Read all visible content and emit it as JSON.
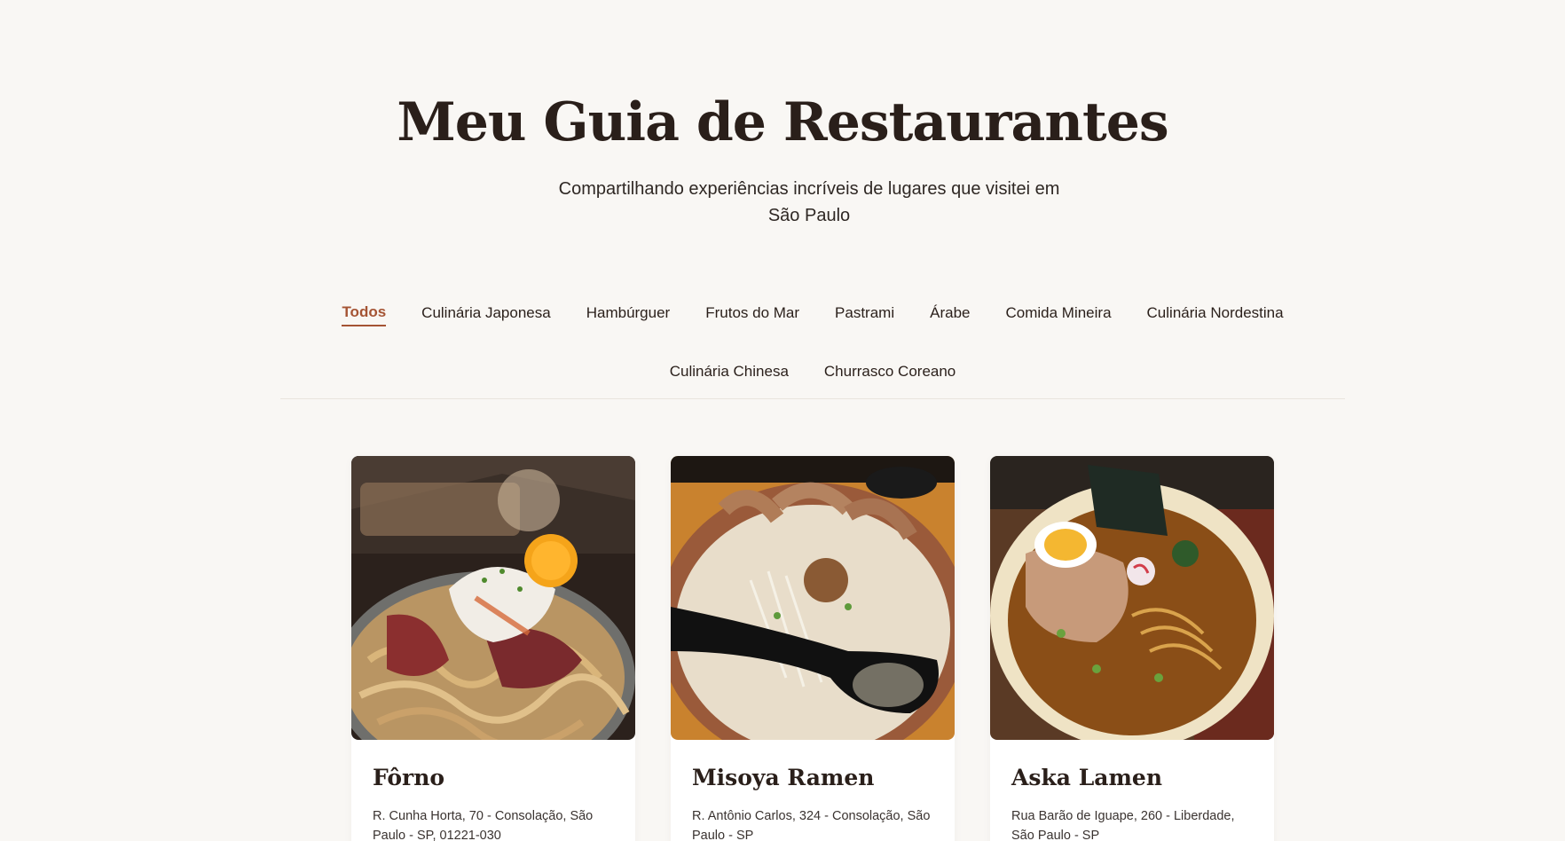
{
  "header": {
    "title": "Meu Guia de Restaurantes",
    "subtitle": "Compartilhando experiências incríveis de lugares que visitei em São Paulo"
  },
  "filters": {
    "active": "Todos",
    "items": [
      "Todos",
      "Culinária Japonesa",
      "Hambúrguer",
      "Frutos do Mar",
      "Pastrami",
      "Árabe",
      "Comida Mineira",
      "Culinária Nordestina",
      "Culinária Chinesa",
      "Churrasco Coreano"
    ]
  },
  "restaurants": [
    {
      "name": "Fôrno",
      "address": "R. Cunha Horta, 70 - Consolação, São Paulo - SP, 01221-030",
      "photo": "noodles-with-pastrami-and-egg-photo"
    },
    {
      "name": "Misoya Ramen",
      "address": "R. Antônio Carlos, 324 - Consolação, São Paulo - SP",
      "photo": "miso-ramen-with-chashu-photo"
    },
    {
      "name": "Aska Lamen",
      "address": "Rua Barão de Iguape, 260 - Liberdade, São Paulo - SP",
      "photo": "shoyu-ramen-with-egg-and-nori-photo"
    }
  ],
  "colors": {
    "background": "#f9f7f4",
    "accent": "#a55434",
    "text": "#2a1f1a",
    "card": "#ffffff"
  }
}
